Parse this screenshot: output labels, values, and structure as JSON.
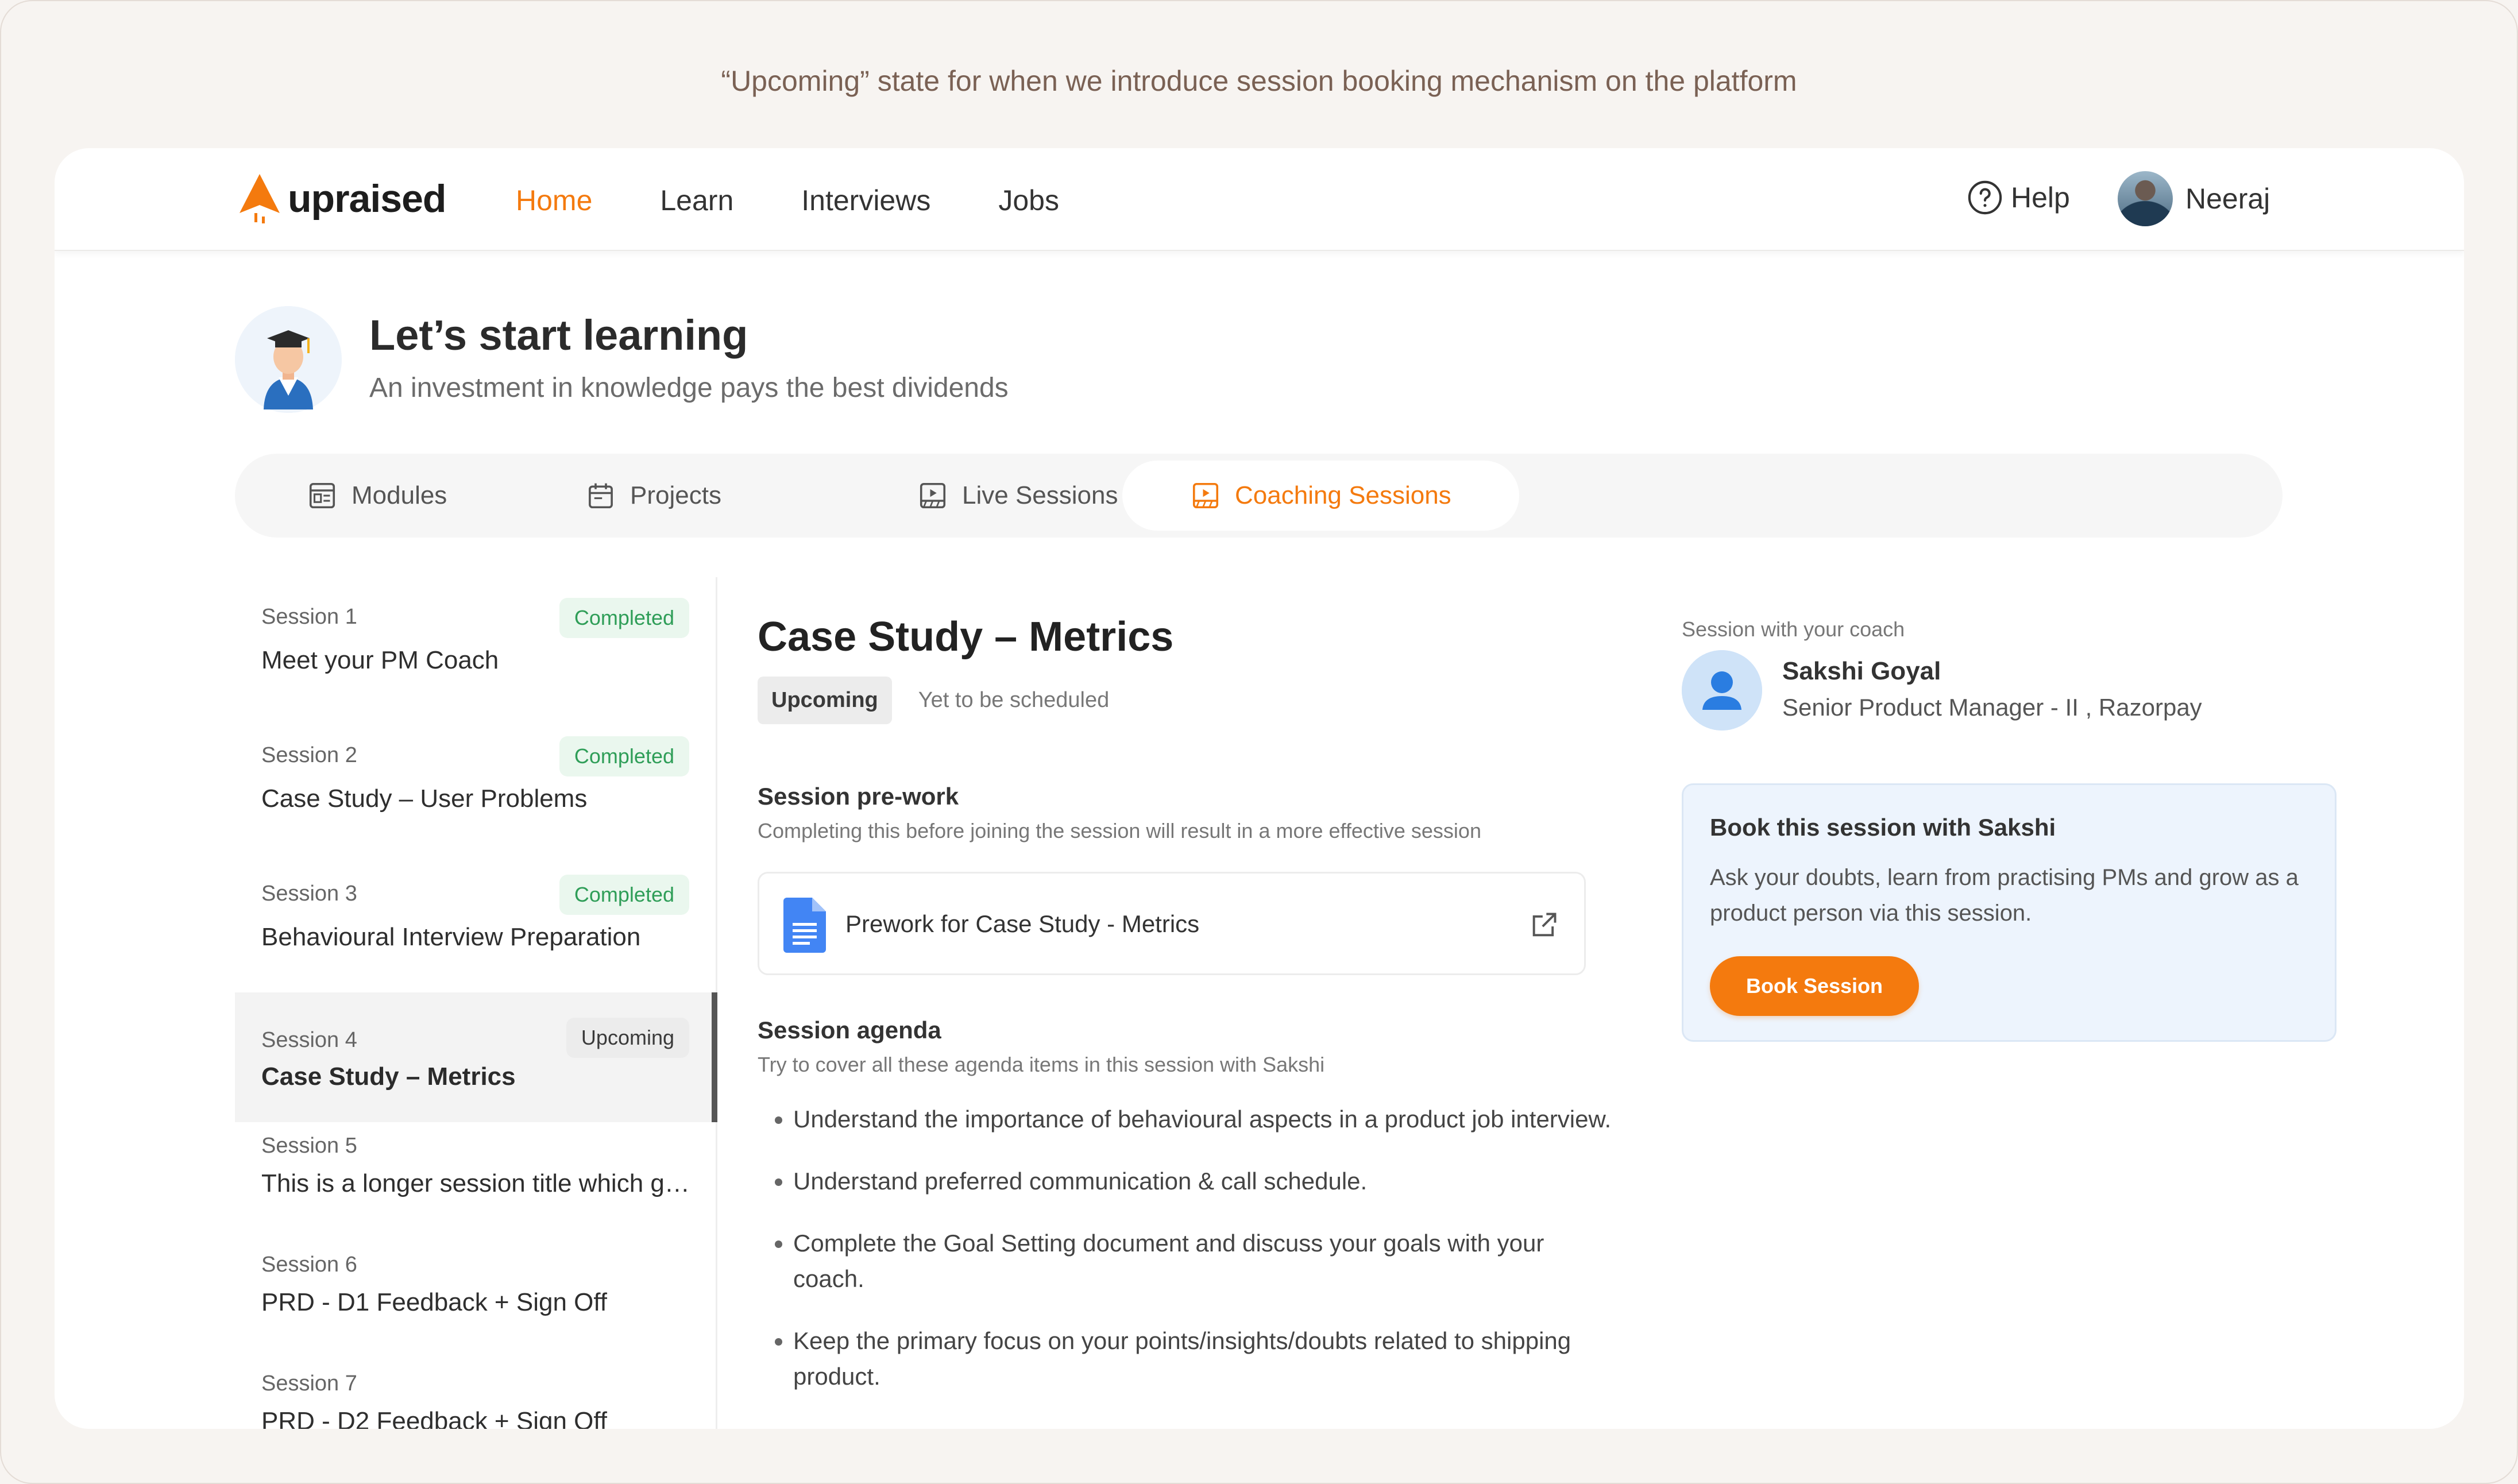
{
  "annotation": "“Upcoming” state for when we introduce session booking mechanism on the platform",
  "header": {
    "logo_text": "upraised",
    "nav": [
      "Home",
      "Learn",
      "Interviews",
      "Jobs"
    ],
    "active_nav": "Home",
    "help_label": "Help",
    "user_name": "Neeraj"
  },
  "hero": {
    "title": "Let’s start learning",
    "subtitle": "An investment in knowledge pays the best dividends"
  },
  "tabs": [
    {
      "label": "Modules",
      "icon": "modules-icon"
    },
    {
      "label": "Projects",
      "icon": "calendar-icon"
    },
    {
      "label": "Live Sessions",
      "icon": "live-video-icon"
    },
    {
      "label": "Coaching Sessions",
      "icon": "coaching-icon",
      "active": true
    }
  ],
  "sessions": [
    {
      "num": "Session 1",
      "title": "Meet your PM Coach",
      "status": "Completed"
    },
    {
      "num": "Session 2",
      "title": "Case Study – User Problems",
      "status": "Completed"
    },
    {
      "num": "Session 3",
      "title": "Behavioural Interview Preparation",
      "status": "Completed"
    },
    {
      "num": "Session 4",
      "title": "Case Study – Metrics",
      "status": "Upcoming",
      "selected": true
    },
    {
      "num": "Session 5",
      "title": "This is a longer session title which go...",
      "status": ""
    },
    {
      "num": "Session 6",
      "title": "PRD - D1 Feedback + Sign Off",
      "status": ""
    },
    {
      "num": "Session 7",
      "title": "PRD - D2 Feedback + Sign Off",
      "status": ""
    }
  ],
  "detail": {
    "title": "Case Study – Metrics",
    "status": "Upcoming",
    "schedule_text": "Yet to be scheduled",
    "prework_heading": "Session pre-work",
    "prework_sub": "Completing this before joining the session will result in a more effective session",
    "prework_doc": "Prework for Case Study - Metrics",
    "agenda_heading": "Session agenda",
    "agenda_sub": "Try to cover all these agenda items in this session with Sakshi",
    "agenda": [
      "Understand the importance of behavioural aspects in a product job interview.",
      "Understand preferred communication & call schedule.",
      "Complete the Goal Setting document and discuss your goals with your coach.",
      "Keep the primary focus on your points/insights/doubts related to shipping product."
    ]
  },
  "coach": {
    "caption": "Session with your coach",
    "name": "Sakshi Goyal",
    "role": "Senior Product Manager - II , Razorpay"
  },
  "booking": {
    "title": "Book this session with Sakshi",
    "description": "Ask your doubts, learn from practising PMs and grow as a product person via this session.",
    "button": "Book Session"
  },
  "colors": {
    "accent": "#f47a0e",
    "completed_bg": "#eaf7ee",
    "completed_text": "#2f9e58",
    "booking_bg": "#edf4fd"
  }
}
